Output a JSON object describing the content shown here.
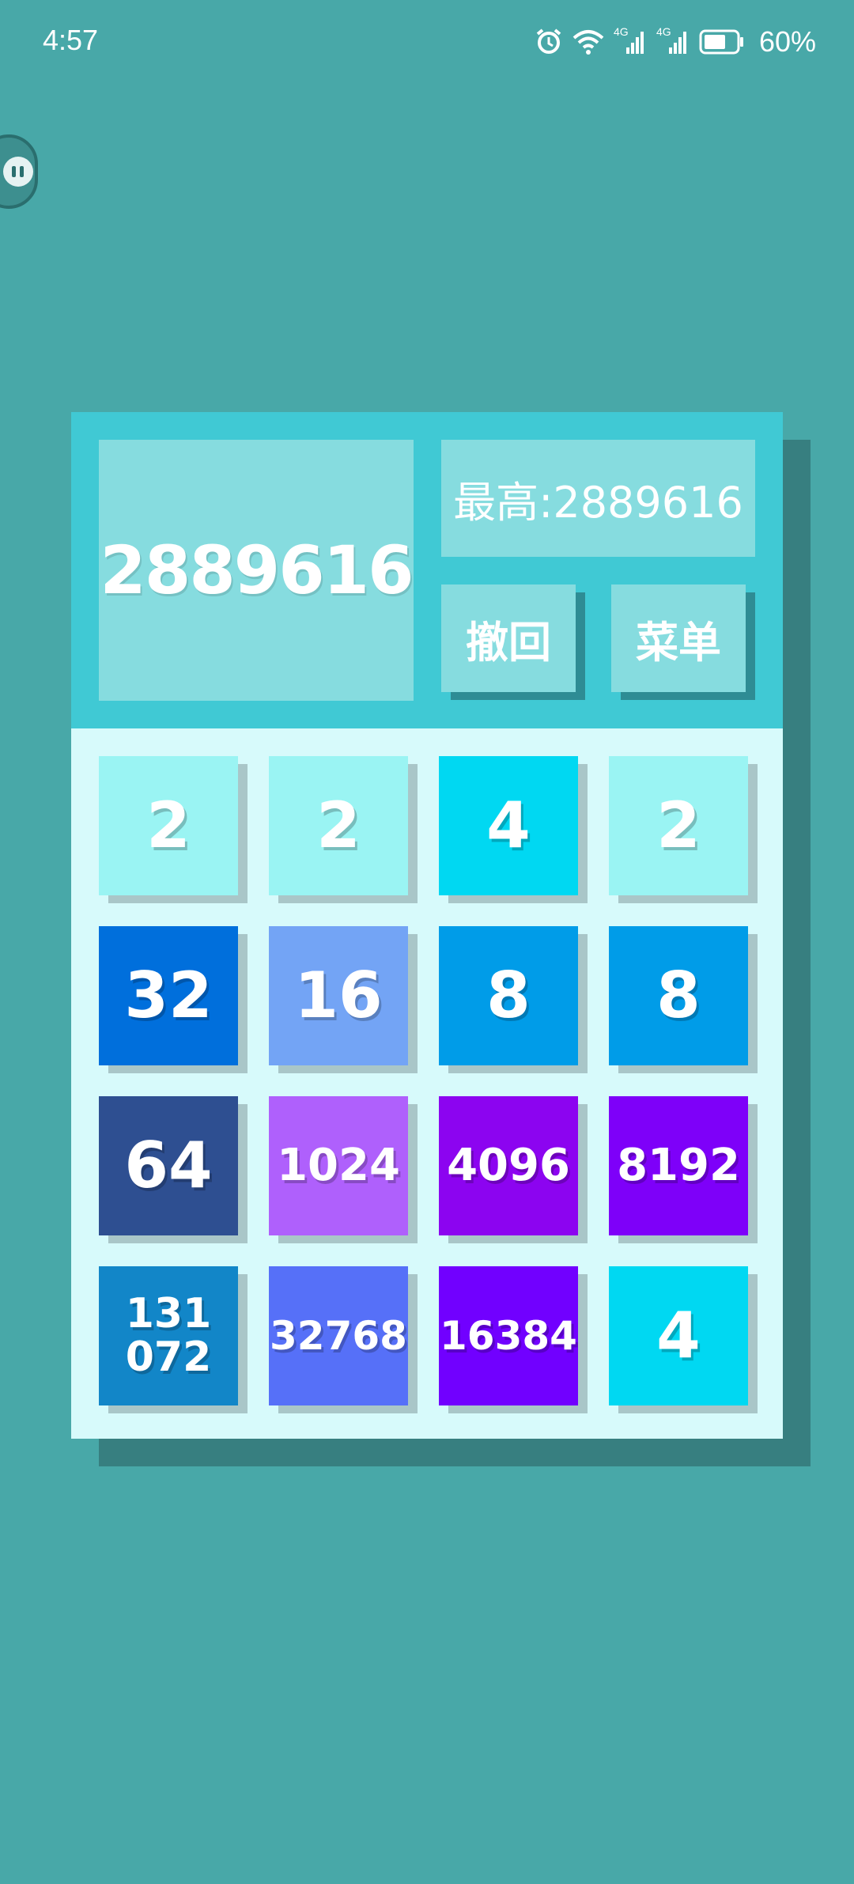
{
  "status_bar": {
    "time": "4:57",
    "battery_percent": "60%",
    "network_1": "4G",
    "network_2": "4G",
    "icons": [
      "alarm-icon",
      "wifi-icon",
      "signal-icon",
      "signal-icon",
      "battery-icon"
    ]
  },
  "header": {
    "score": "2889616",
    "best": "最高:2889616",
    "undo_label": "撤回",
    "menu_label": "菜单"
  },
  "colors": {
    "background": "#48a8a8",
    "header_bg": "#40c9d4",
    "panel_bg": "#86dcdf",
    "grid_bg": "#d7fafb",
    "tile_2": "#9af4f3",
    "tile_4": "#00d8f2",
    "tile_8": "#009ce8",
    "tile_16": "#73a4f5",
    "tile_32": "#006fdc",
    "tile_64": "#2e4f91",
    "tile_1024": "#af60fc",
    "tile_4096": "#8c04f0",
    "tile_8192": "#7e00f9",
    "tile_16384": "#7100ff",
    "tile_32768": "#5670f8",
    "tile_131072": "#1286c8"
  },
  "board": {
    "rows": [
      [
        {
          "value": "2",
          "line1": "2",
          "line2": ""
        },
        {
          "value": "2",
          "line1": "2",
          "line2": ""
        },
        {
          "value": "4",
          "line1": "4",
          "line2": ""
        },
        {
          "value": "2",
          "line1": "2",
          "line2": ""
        }
      ],
      [
        {
          "value": "32",
          "line1": "32",
          "line2": ""
        },
        {
          "value": "16",
          "line1": "16",
          "line2": ""
        },
        {
          "value": "8",
          "line1": "8",
          "line2": ""
        },
        {
          "value": "8",
          "line1": "8",
          "line2": ""
        }
      ],
      [
        {
          "value": "64",
          "line1": "64",
          "line2": ""
        },
        {
          "value": "1024",
          "line1": "1024",
          "line2": ""
        },
        {
          "value": "4096",
          "line1": "4096",
          "line2": ""
        },
        {
          "value": "8192",
          "line1": "8192",
          "line2": ""
        }
      ],
      [
        {
          "value": "131072",
          "line1": "131",
          "line2": "072"
        },
        {
          "value": "32768",
          "line1": "32768",
          "line2": ""
        },
        {
          "value": "16384",
          "line1": "16384",
          "line2": ""
        },
        {
          "value": "4",
          "line1": "4",
          "line2": ""
        }
      ]
    ]
  }
}
